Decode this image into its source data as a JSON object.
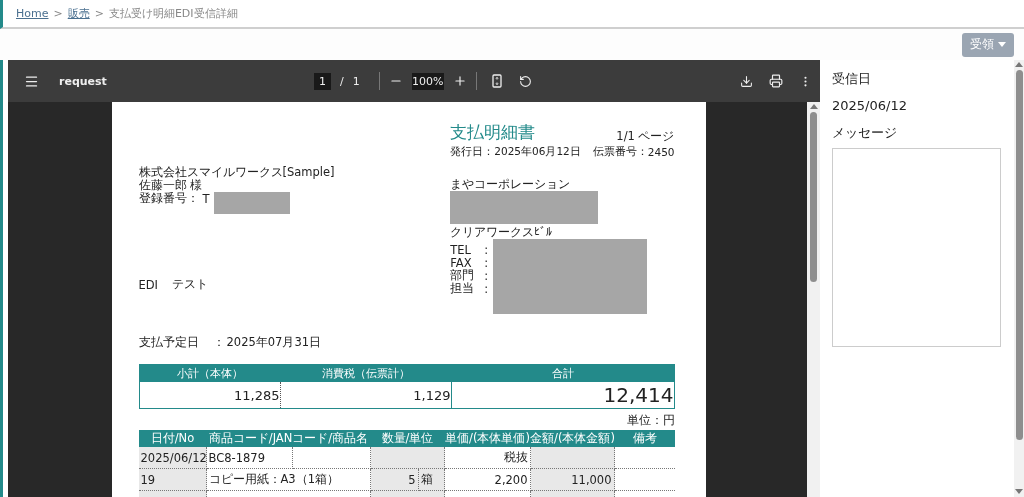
{
  "breadcrumb": [
    {
      "label": "Home",
      "link": true
    },
    {
      "label": ">",
      "link": false
    },
    {
      "label": "販売",
      "link": true
    },
    {
      "label": ">",
      "link": false
    },
    {
      "label": "支払受け明細EDI受信詳細",
      "link": false
    }
  ],
  "action_button": {
    "label": "受領",
    "disabled": true
  },
  "viewer": {
    "title": "request",
    "page": "1",
    "page_sep": "/",
    "page_total": "1",
    "zoom": "100%"
  },
  "document": {
    "title": "支払明細書",
    "page_label": "1/1 ページ",
    "issue": [
      {
        "label": "発行日：",
        "value": "2025年06月12日"
      },
      {
        "label": "伝票番号：",
        "value": "2450"
      }
    ],
    "recipient": {
      "company": "株式会社スマイルワークス[Sample]",
      "person": "佐藤一郎 様",
      "reg_label": "登録番号：",
      "reg_value": "T"
    },
    "sender": {
      "company": "まやコーポレーション",
      "building": "クリアワークスﾋﾞﾙ",
      "contacts": [
        {
          "label": "TEL",
          "sep": ":"
        },
        {
          "label": "FAX",
          "sep": ":"
        },
        {
          "label": "部門",
          "sep": ":"
        },
        {
          "label": "担当",
          "sep": ":"
        }
      ]
    },
    "subject": {
      "label": "EDI",
      "value": "テスト"
    },
    "due": {
      "label": "支払予定日",
      "sep": "：",
      "value": "2025年07月31日"
    },
    "summary": {
      "columns": [
        "小計（本体）",
        "消費税（伝票計）",
        "合計"
      ],
      "values": [
        "11,285",
        "1,129",
        "12,414"
      ]
    },
    "unit_note": "単位：円",
    "items": {
      "columns": [
        "日付/No",
        "商品コード/JANコード/商品名",
        "数量/単位",
        "単価/(本体単価)",
        "金額/(本体金額)",
        "備考"
      ],
      "rows": [
        {
          "kind": "code",
          "date": "2025/06/12",
          "code": "BC8-1879",
          "price": "税抜"
        },
        {
          "kind": "item",
          "date": "19",
          "name": "コピー用紙：A3（1箱）",
          "qty": "5",
          "unit": "箱",
          "price": "2,200",
          "amount": "11,000"
        },
        {
          "kind": "blank"
        }
      ]
    }
  },
  "side": {
    "date_label": "受信日",
    "date": "2025/06/12",
    "message_label": "メッセージ"
  }
}
